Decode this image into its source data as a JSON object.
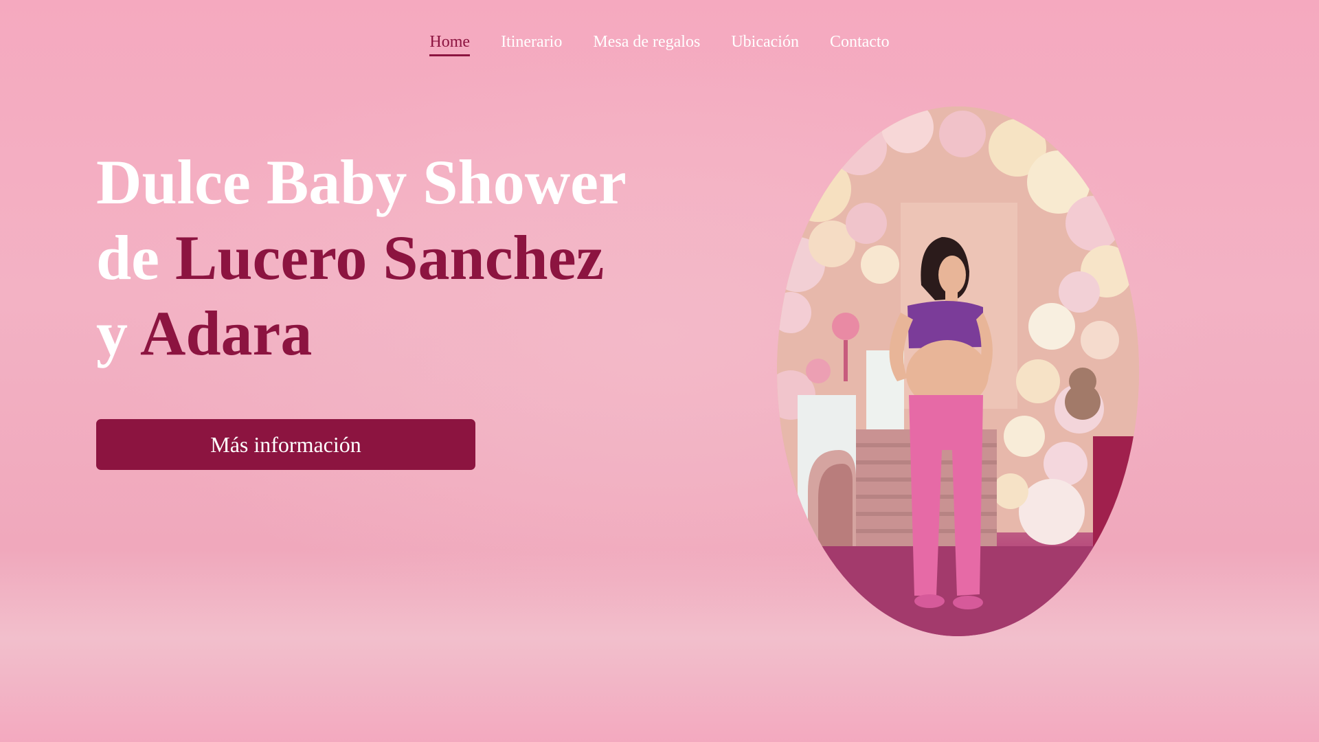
{
  "nav": {
    "items": [
      {
        "label": "Home",
        "active": true
      },
      {
        "label": "Itinerario"
      },
      {
        "label": "Mesa de regalos"
      },
      {
        "label": "Ubicación"
      },
      {
        "label": "Contacto"
      }
    ]
  },
  "hero": {
    "title_line1": "Dulce Baby Shower",
    "title_line2_prefix": "de ",
    "title_line2_accent": "Lucero Sanchez",
    "title_line3_prefix": "y ",
    "title_line3_accent": "Adara",
    "cta_label": "Más información"
  },
  "colors": {
    "accent": "#8c1440",
    "background": "#f5a9bf",
    "text_light": "#ffffff"
  }
}
